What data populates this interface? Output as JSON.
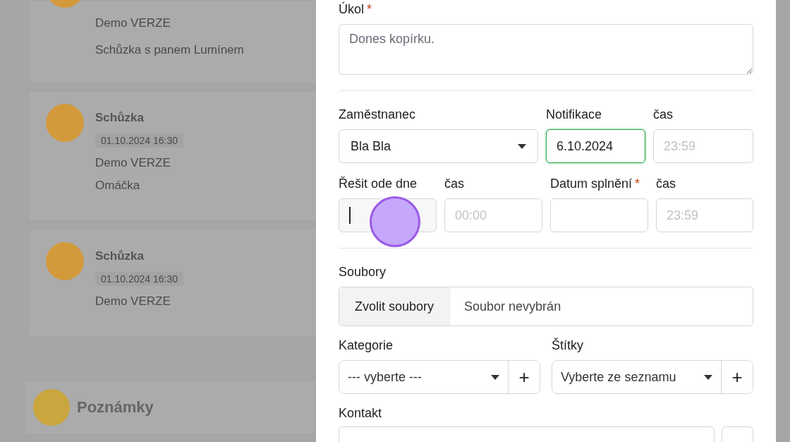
{
  "background": {
    "cards": [
      {
        "cut": true,
        "lines": [
          "Demo VERZE",
          "Schůzka s panem Lumínem"
        ]
      },
      {
        "cut": false,
        "title": "Schůzka",
        "date": "01.10.2024 16:30",
        "lines": [
          "Demo VERZE",
          "Omáčka"
        ]
      },
      {
        "cut": false,
        "title": "Schůzka",
        "date": "01.10.2024 16:30",
        "lines": [
          "Demo VERZE"
        ]
      }
    ],
    "notes_title": "Poznámky"
  },
  "form": {
    "task": {
      "label": "Úkol",
      "mark": "*",
      "placeholder": "Dones kopírku."
    },
    "employee": {
      "label": "Zaměstnanec",
      "value": "Bla Bla"
    },
    "notification": {
      "label": "Notifikace",
      "value": "6.10.2024",
      "focused": true
    },
    "notification_time": {
      "label": "čas",
      "placeholder": "23:59"
    },
    "solve_from": {
      "label": "Řešit ode dne",
      "typing": true
    },
    "solve_from_time": {
      "label": "čas",
      "placeholder": "00:00"
    },
    "due_date": {
      "label": "Datum splnění",
      "mark": "*"
    },
    "due_time": {
      "label": "čas",
      "placeholder": "23:59"
    },
    "files": {
      "label": "Soubory",
      "button": "Zvolit soubory",
      "status": "Soubor nevybrán"
    },
    "category": {
      "label": "Kategorie",
      "value": "--- vyberte ---",
      "add": "+"
    },
    "tags": {
      "label": "Štítky",
      "value": "Vyberte ze seznamu",
      "add": "+"
    },
    "contact": {
      "label": "Kontakt"
    }
  }
}
